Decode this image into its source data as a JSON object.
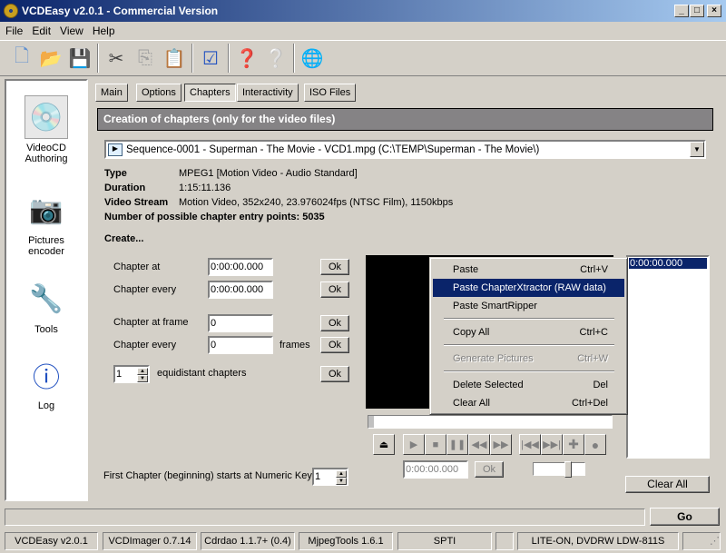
{
  "window": {
    "title": "VCDEasy v2.0.1 - Commercial Version",
    "minimize": "_",
    "maximize": "□",
    "close": "×"
  },
  "menubar": [
    "File",
    "Edit",
    "View",
    "Help"
  ],
  "toolbar": [
    {
      "name": "new-file-icon",
      "glyph": "🗋"
    },
    {
      "name": "open-folder-icon",
      "glyph": "📂"
    },
    {
      "name": "save-icon",
      "glyph": "💾"
    },
    {
      "name": "cut-icon",
      "glyph": "✂"
    },
    {
      "name": "copy-icon",
      "glyph": "⎘"
    },
    {
      "name": "paste-icon",
      "glyph": "📋"
    },
    {
      "name": "check-document-icon",
      "glyph": "☑"
    },
    {
      "name": "help-video-icon",
      "glyph": "❓"
    },
    {
      "name": "help-cd-icon",
      "glyph": "❔"
    },
    {
      "name": "web-globe-icon",
      "glyph": "🌐"
    }
  ],
  "sidebar": [
    {
      "label1": "VideoCD",
      "label2": "Authoring",
      "icon": "videocd-authoring-icon",
      "glyph": "💿",
      "selected": true
    },
    {
      "label1": "Pictures",
      "label2": "encoder",
      "icon": "pictures-encoder-icon",
      "glyph": "📷"
    },
    {
      "label1": "Tools",
      "label2": "",
      "icon": "tools-icon",
      "glyph": "🔧"
    },
    {
      "label1": "Log",
      "label2": "",
      "icon": "log-icon",
      "glyph": "ⓘ"
    }
  ],
  "tabs": [
    "Main",
    "Options",
    "Chapters",
    "Interactivity",
    "ISO Files"
  ],
  "active_tab": "Chapters",
  "header": "Creation of chapters (only for the video files)",
  "file_combo": "Sequence-0001 - Superman - The Movie - VCD1.mpg  (C:\\TEMP\\Superman - The Movie\\)",
  "info": {
    "type_label": "Type",
    "type_value": "MPEG1   [Motion Video - Audio Standard]",
    "duration_label": "Duration",
    "duration_value": "1:15:11.136",
    "stream_label": "Video Stream",
    "stream_value": "Motion Video, 352x240, 23.976024fps (NTSC Film), 1150kbps",
    "entry_points": "Number of possible chapter entry points: 5035"
  },
  "create_label": "Create...",
  "form": {
    "chapter_at_label": "Chapter at",
    "chapter_at_value": "0:00:00.000",
    "chapter_every_label": "Chapter every",
    "chapter_every_value": "0:00:00.000",
    "chapter_at_frame_label": "Chapter at frame",
    "chapter_at_frame_value": "0",
    "chapter_every_frames_label": "Chapter every",
    "chapter_every_frames_value": "0",
    "frames_label": "frames",
    "equidistant_value": "1",
    "equidistant_label": "equidistant chapters",
    "ok": "Ok",
    "first_chapter_label": "First Chapter (beginning) starts at Numeric Key",
    "first_chapter_value": "1"
  },
  "context_menu": [
    {
      "label": "Paste",
      "shortcut": "Ctrl+V"
    },
    {
      "label": "Paste ChapterXtractor (RAW data)",
      "shortcut": "",
      "highlighted": true
    },
    {
      "label": "Paste SmartRipper",
      "shortcut": ""
    },
    {
      "label": "Copy All",
      "shortcut": "Ctrl+C"
    },
    {
      "label": "Generate Pictures",
      "shortcut": "Ctrl+W",
      "disabled": true
    },
    {
      "label": "Delete Selected",
      "shortcut": "Del"
    },
    {
      "label": "Clear All",
      "shortcut": "Ctrl+Del"
    }
  ],
  "chapter_list": [
    "0:00:00.000"
  ],
  "player": {
    "time_value": "0:00:00.000",
    "ok": "Ok",
    "seek_position": 0,
    "volume_fraction": 0.75
  },
  "clear_all": "Clear All",
  "go": "Go",
  "statusbar": [
    "VCDEasy v2.0.1",
    "VCDImager 0.7.14",
    "Cdrdao 1.1.7+ (0.4)",
    "MjpegTools 1.6.1",
    "SPTI",
    "",
    "LITE-ON, DVDRW LDW-811S"
  ]
}
